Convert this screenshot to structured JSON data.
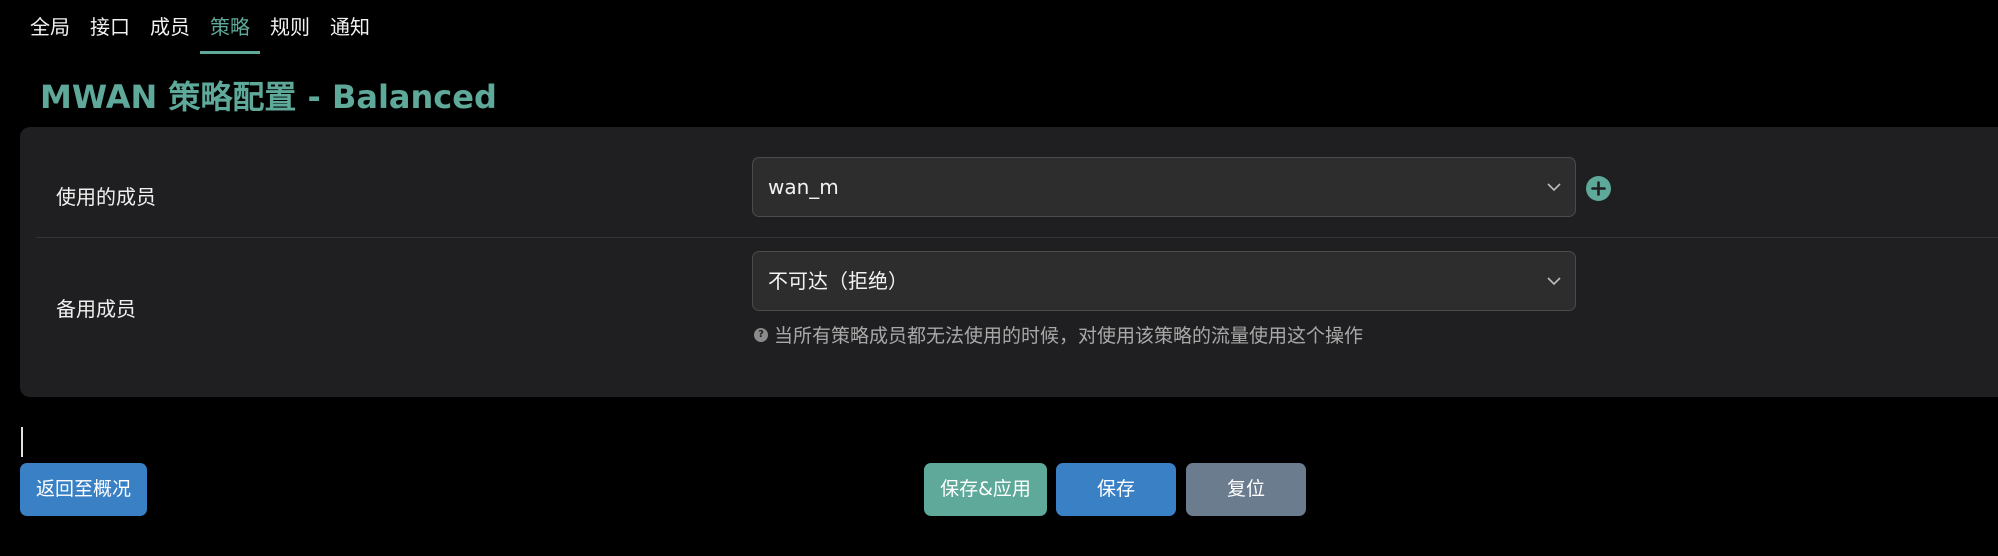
{
  "tabs": [
    {
      "label": "全局"
    },
    {
      "label": "接口"
    },
    {
      "label": "成员"
    },
    {
      "label": "策略",
      "active": true
    },
    {
      "label": "规则"
    },
    {
      "label": "通知"
    }
  ],
  "page": {
    "title": "MWAN 策略配置 - Balanced"
  },
  "form": {
    "members": {
      "label": "使用的成员",
      "value": "wan_m"
    },
    "fallback": {
      "label": "备用成员",
      "value": "不可达（拒绝）",
      "hint": "当所有策略成员都无法使用的时候，对使用该策略的流量使用这个操作"
    }
  },
  "buttons": {
    "back": "返回至概况",
    "save_apply": "保存&应用",
    "save": "保存",
    "reset": "复位"
  },
  "colors": {
    "accent": "#5ea99a",
    "primary": "#3a80c5",
    "reset": "#6b7c8f"
  },
  "icons": [
    "chevron-down-icon",
    "plus-circle-icon",
    "question-circle-icon"
  ]
}
